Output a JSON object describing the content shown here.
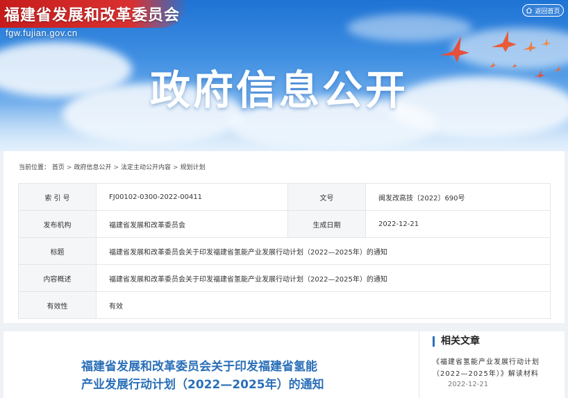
{
  "header": {
    "site_name": "福建省发展和改革委员会",
    "domain": "fgw.fujian.gov.cn",
    "home_link": "返回首页",
    "section_title": "政府信息公开",
    "colors": {
      "ribbon": "#d32a2a",
      "sky": "#3f8fe2",
      "bird": "#e8503a"
    }
  },
  "breadcrumb": {
    "label": "当前位置：",
    "items": [
      "首页",
      "政府信息公开",
      "法定主动公开内容",
      "规划计划"
    ],
    "separator": ">"
  },
  "meta": {
    "index_label": "索 引 号",
    "index_value": "FJ00102-0300-2022-00411",
    "doc_label": "文号",
    "doc_value": "闽发改高技〔2022〕690号",
    "org_label": "发布机构",
    "org_value": "福建省发展和改革委员会",
    "date_label": "生成日期",
    "date_value": "2022-12-21",
    "title_label": "标题",
    "title_value": "福建省发展和改革委员会关于印发福建省氢能产业发展行动计划（2022—2025年）的通知",
    "summary_label": "内容概述",
    "summary_value": "福建省发展和改革委员会关于印发福建省氢能产业发展行动计划（2022—2025年）的通知",
    "validity_label": "有效性",
    "validity_value": "有效"
  },
  "article": {
    "title_line1": "福建省发展和改革委员会关于印发福建省氢能",
    "title_line2": "产业发展行动计划（2022—2025年）的通知"
  },
  "related": {
    "heading": "相关文章",
    "items": [
      {
        "text": "《福建省氢能产业发展行动计划（2022—2025年）》解读材料",
        "date": "2022-12-21"
      }
    ]
  }
}
